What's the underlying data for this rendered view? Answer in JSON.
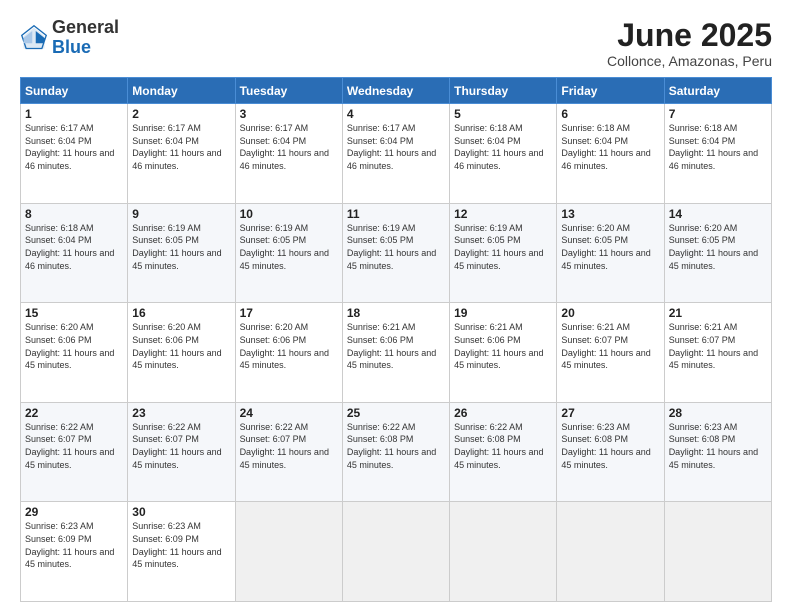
{
  "header": {
    "logo_general": "General",
    "logo_blue": "Blue",
    "month_title": "June 2025",
    "location": "Collonce, Amazonas, Peru"
  },
  "weekdays": [
    "Sunday",
    "Monday",
    "Tuesday",
    "Wednesday",
    "Thursday",
    "Friday",
    "Saturday"
  ],
  "weeks": [
    [
      {
        "day": "1",
        "info": "Sunrise: 6:17 AM\nSunset: 6:04 PM\nDaylight: 11 hours and 46 minutes."
      },
      {
        "day": "2",
        "info": "Sunrise: 6:17 AM\nSunset: 6:04 PM\nDaylight: 11 hours and 46 minutes."
      },
      {
        "day": "3",
        "info": "Sunrise: 6:17 AM\nSunset: 6:04 PM\nDaylight: 11 hours and 46 minutes."
      },
      {
        "day": "4",
        "info": "Sunrise: 6:17 AM\nSunset: 6:04 PM\nDaylight: 11 hours and 46 minutes."
      },
      {
        "day": "5",
        "info": "Sunrise: 6:18 AM\nSunset: 6:04 PM\nDaylight: 11 hours and 46 minutes."
      },
      {
        "day": "6",
        "info": "Sunrise: 6:18 AM\nSunset: 6:04 PM\nDaylight: 11 hours and 46 minutes."
      },
      {
        "day": "7",
        "info": "Sunrise: 6:18 AM\nSunset: 6:04 PM\nDaylight: 11 hours and 46 minutes."
      }
    ],
    [
      {
        "day": "8",
        "info": "Sunrise: 6:18 AM\nSunset: 6:04 PM\nDaylight: 11 hours and 46 minutes."
      },
      {
        "day": "9",
        "info": "Sunrise: 6:19 AM\nSunset: 6:05 PM\nDaylight: 11 hours and 45 minutes."
      },
      {
        "day": "10",
        "info": "Sunrise: 6:19 AM\nSunset: 6:05 PM\nDaylight: 11 hours and 45 minutes."
      },
      {
        "day": "11",
        "info": "Sunrise: 6:19 AM\nSunset: 6:05 PM\nDaylight: 11 hours and 45 minutes."
      },
      {
        "day": "12",
        "info": "Sunrise: 6:19 AM\nSunset: 6:05 PM\nDaylight: 11 hours and 45 minutes."
      },
      {
        "day": "13",
        "info": "Sunrise: 6:20 AM\nSunset: 6:05 PM\nDaylight: 11 hours and 45 minutes."
      },
      {
        "day": "14",
        "info": "Sunrise: 6:20 AM\nSunset: 6:05 PM\nDaylight: 11 hours and 45 minutes."
      }
    ],
    [
      {
        "day": "15",
        "info": "Sunrise: 6:20 AM\nSunset: 6:06 PM\nDaylight: 11 hours and 45 minutes."
      },
      {
        "day": "16",
        "info": "Sunrise: 6:20 AM\nSunset: 6:06 PM\nDaylight: 11 hours and 45 minutes."
      },
      {
        "day": "17",
        "info": "Sunrise: 6:20 AM\nSunset: 6:06 PM\nDaylight: 11 hours and 45 minutes."
      },
      {
        "day": "18",
        "info": "Sunrise: 6:21 AM\nSunset: 6:06 PM\nDaylight: 11 hours and 45 minutes."
      },
      {
        "day": "19",
        "info": "Sunrise: 6:21 AM\nSunset: 6:06 PM\nDaylight: 11 hours and 45 minutes."
      },
      {
        "day": "20",
        "info": "Sunrise: 6:21 AM\nSunset: 6:07 PM\nDaylight: 11 hours and 45 minutes."
      },
      {
        "day": "21",
        "info": "Sunrise: 6:21 AM\nSunset: 6:07 PM\nDaylight: 11 hours and 45 minutes."
      }
    ],
    [
      {
        "day": "22",
        "info": "Sunrise: 6:22 AM\nSunset: 6:07 PM\nDaylight: 11 hours and 45 minutes."
      },
      {
        "day": "23",
        "info": "Sunrise: 6:22 AM\nSunset: 6:07 PM\nDaylight: 11 hours and 45 minutes."
      },
      {
        "day": "24",
        "info": "Sunrise: 6:22 AM\nSunset: 6:07 PM\nDaylight: 11 hours and 45 minutes."
      },
      {
        "day": "25",
        "info": "Sunrise: 6:22 AM\nSunset: 6:08 PM\nDaylight: 11 hours and 45 minutes."
      },
      {
        "day": "26",
        "info": "Sunrise: 6:22 AM\nSunset: 6:08 PM\nDaylight: 11 hours and 45 minutes."
      },
      {
        "day": "27",
        "info": "Sunrise: 6:23 AM\nSunset: 6:08 PM\nDaylight: 11 hours and 45 minutes."
      },
      {
        "day": "28",
        "info": "Sunrise: 6:23 AM\nSunset: 6:08 PM\nDaylight: 11 hours and 45 minutes."
      }
    ],
    [
      {
        "day": "29",
        "info": "Sunrise: 6:23 AM\nSunset: 6:09 PM\nDaylight: 11 hours and 45 minutes."
      },
      {
        "day": "30",
        "info": "Sunrise: 6:23 AM\nSunset: 6:09 PM\nDaylight: 11 hours and 45 minutes."
      },
      {
        "day": "",
        "info": ""
      },
      {
        "day": "",
        "info": ""
      },
      {
        "day": "",
        "info": ""
      },
      {
        "day": "",
        "info": ""
      },
      {
        "day": "",
        "info": ""
      }
    ]
  ]
}
